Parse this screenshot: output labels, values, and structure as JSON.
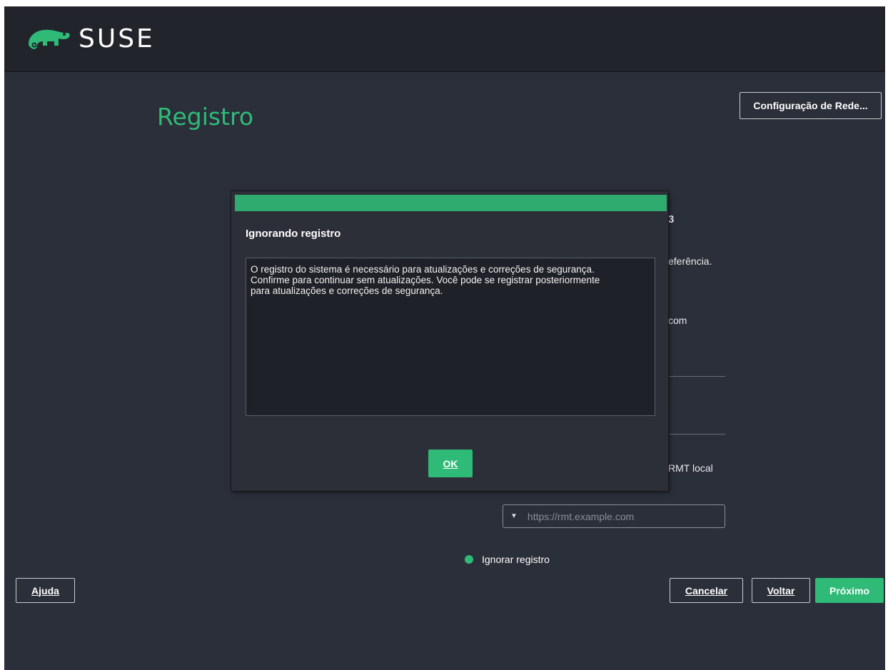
{
  "header": {
    "brand": "SUSE"
  },
  "page": {
    "title": "Registro"
  },
  "buttons": {
    "network": "Configuração de Rede...",
    "help": "Ajuda",
    "cancel": "Cancelar",
    "back": "Voltar",
    "next": "Próximo"
  },
  "background_form": {
    "fragment_1": "eferência.",
    "fragment_2": "com",
    "fragment_3": "RMT local",
    "rmt_placeholder": "https://rmt.example.com",
    "skip_option": "Ignorar registro"
  },
  "dialog": {
    "title": "Ignorando registro",
    "message": "O registro do sistema é necessário para atualizações e correções de segurança.\nConfirme para continuar sem atualizações. Você pode se registrar posteriormente\npara atualizações e correções de segurança.",
    "ok": "OK"
  },
  "colors": {
    "accent": "#30ba78",
    "background": "#2b2f3a",
    "topbar": "#21242b"
  }
}
